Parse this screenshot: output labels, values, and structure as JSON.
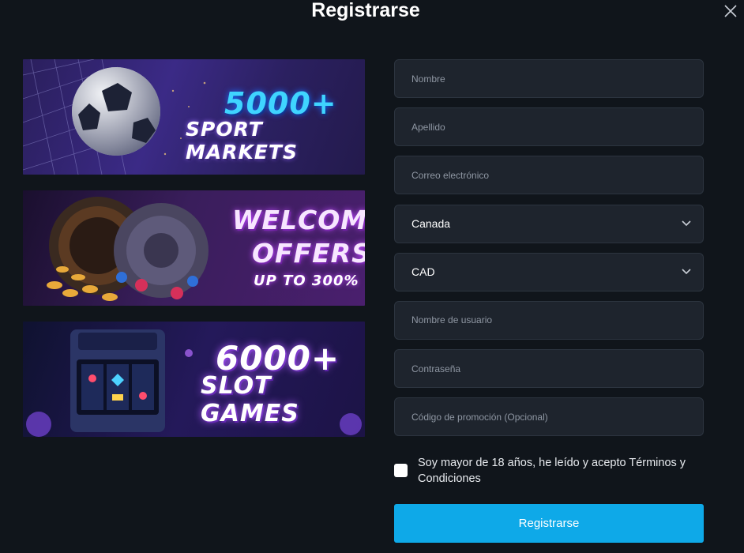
{
  "modal": {
    "title": "Registrarse"
  },
  "banners": [
    {
      "line1": "5000+",
      "line2": "SPORT MARKETS"
    },
    {
      "line1": "WELCOME",
      "line2": "OFFERS",
      "line3": "UP TO 300%"
    },
    {
      "line1": "6000+",
      "line2": "SLOT GAMES"
    }
  ],
  "form": {
    "first_name_placeholder": "Nombre",
    "last_name_placeholder": "Apellido",
    "email_placeholder": "Correo electrónico",
    "country_value": "Canada",
    "currency_value": "CAD",
    "username_placeholder": "Nombre de usuario",
    "password_placeholder": "Contraseña",
    "promo_placeholder": "Código de promoción (Opcional)",
    "terms_label": "Soy mayor de 18 años, he leído y acepto Términos y Condiciones",
    "submit_label": "Registrarse"
  },
  "colors": {
    "background": "#10151b",
    "field_bg": "#1e242d",
    "accent": "#0ea9e8"
  },
  "icons": [
    "close-icon",
    "chevron-down-icon"
  ]
}
